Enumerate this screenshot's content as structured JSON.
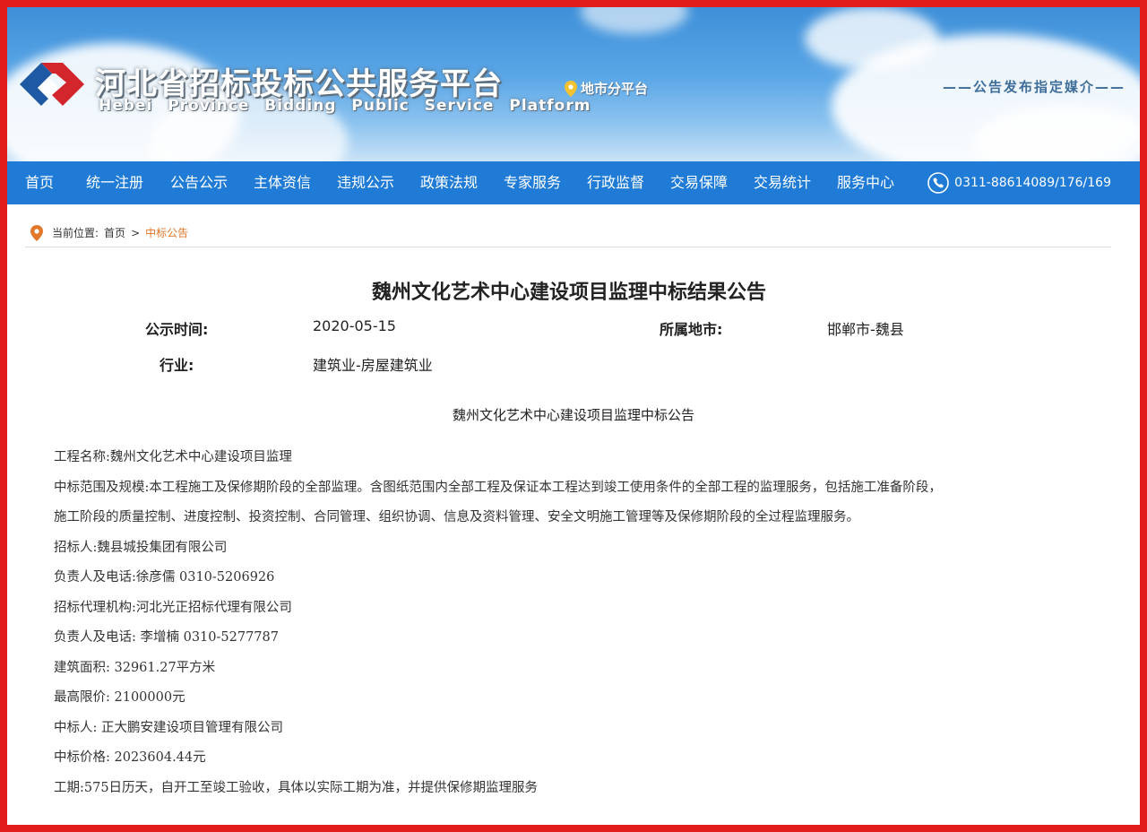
{
  "header": {
    "site_title_cn": "河北省招标投标公共服务平台",
    "site_title_en": "Hebei Province Bidding Public Service Platform",
    "city_platform": "地市分平台",
    "media_slogan": "——公告发布指定媒介——"
  },
  "nav": {
    "items": [
      "首页",
      "统一注册",
      "公告公示",
      "主体资信",
      "违规公示",
      "政策法规",
      "专家服务",
      "行政监督",
      "交易保障",
      "交易统计",
      "服务中心"
    ],
    "phone": "0311-88614089/176/169"
  },
  "breadcrumb": {
    "prefix": "当前位置:",
    "home": "首页",
    "separator": ">",
    "current": "中标公告"
  },
  "article": {
    "title": "魏州文化艺术中心建设项目监理中标结果公告",
    "meta": {
      "publish_label": "公示时间:",
      "publish_value": "2020-05-15",
      "region_label": "所属地市:",
      "region_value": "邯郸市-魏县",
      "industry_label": "行业:",
      "industry_value": "建筑业-房屋建筑业"
    },
    "sub_title": "魏州文化艺术中心建设项目监理中标公告",
    "lines": [
      "工程名称:魏州文化艺术中心建设项目监理",
      "中标范围及规模:本工程施工及保修期阶段的全部监理。含图纸范围内全部工程及保证本工程达到竣工使用条件的全部工程的监理服务，包括施工准备阶段，",
      "施工阶段的质量控制、进度控制、投资控制、合同管理、组织协调、信息及资料管理、安全文明施工管理等及保修期阶段的全过程监理服务。",
      "招标人:魏县城投集团有限公司",
      "负责人及电话:徐彦儒    0310-5206926",
      "招标代理机构:河北光正招标代理有限公司",
      "负责人及电话: 李增楠    0310-5277787",
      "建筑面积: 32961.27平方米",
      "最高限价: 2100000元",
      "中标人: 正大鹏安建设项目管理有限公司",
      "中标价格: 2023604.44元",
      "工期:575日历天，自开工至竣工验收，具体以实际工期为准，并提供保修期监理服务"
    ]
  },
  "colors": {
    "border_red": "#e21b1b",
    "nav_blue": "#1f7bd6",
    "breadcrumb_current": "#e2782b",
    "logo_red": "#d3252c",
    "logo_blue": "#1d5aa3"
  },
  "icons": {
    "logo": "platform-logo-icon",
    "location": "location-pin-icon",
    "phone": "phone-icon"
  }
}
